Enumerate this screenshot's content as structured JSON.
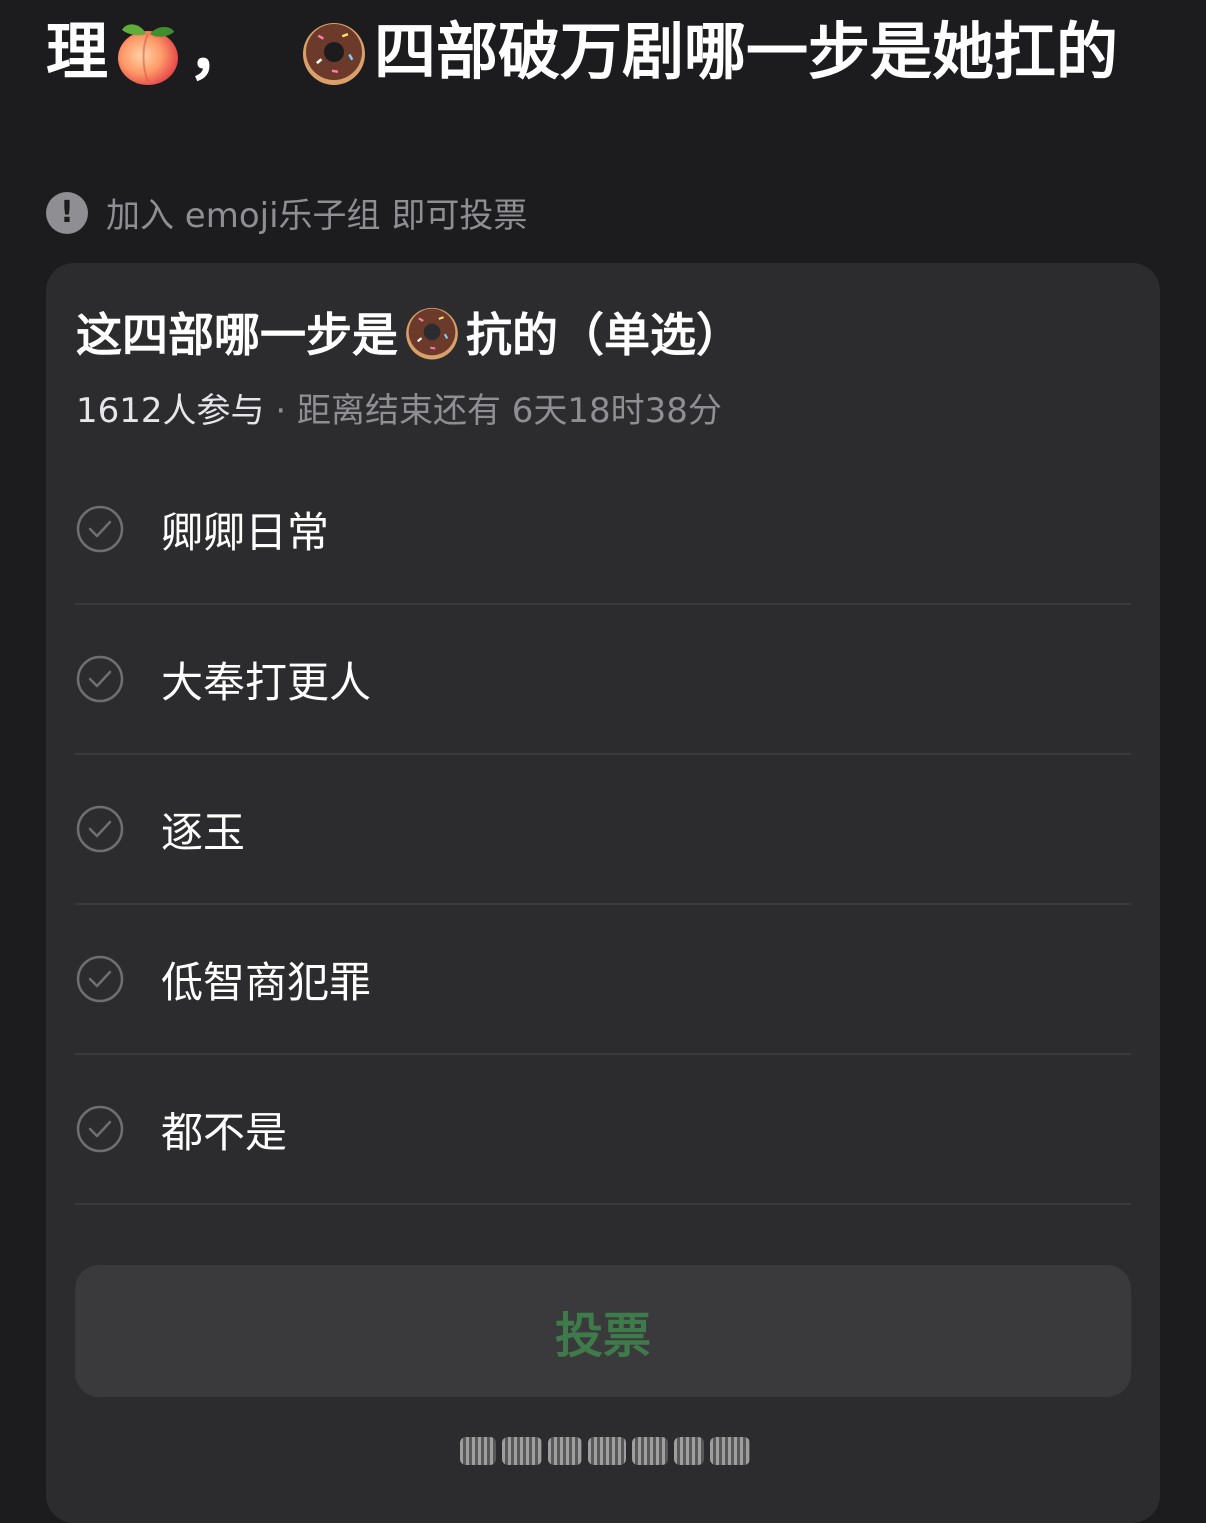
{
  "post": {
    "title_prefix": "理",
    "title_mid": "，",
    "title_suffix": "四部破万剧哪一步是她扛的",
    "emoji_1": "peach-icon",
    "emoji_2": "donut-icon"
  },
  "notice": {
    "icon": "exclamation-icon",
    "text": "加入 emoji乐子组 即可投票"
  },
  "poll": {
    "title_prefix": "这四部哪一步是",
    "title_suffix": "抗的（单选）",
    "title_emoji": "donut-icon",
    "participants": "1612人参与",
    "separator": " · ",
    "deadline": "距离结束还有 6天18时38分",
    "options": [
      {
        "label": "卿卿日常",
        "icon": "check-circle-icon"
      },
      {
        "label": "大奉打更人",
        "icon": "check-circle-icon"
      },
      {
        "label": "逐玉",
        "icon": "check-circle-icon"
      },
      {
        "label": "低智商犯罪",
        "icon": "check-circle-icon"
      },
      {
        "label": "都不是",
        "icon": "check-circle-icon"
      }
    ],
    "vote_label": "投票"
  },
  "colors": {
    "background": "#1c1c1e",
    "card": "#2c2c2e",
    "muted_text": "#8e8e93",
    "vote_text": "#3f7a4a",
    "button_bg": "#3a3a3c"
  }
}
